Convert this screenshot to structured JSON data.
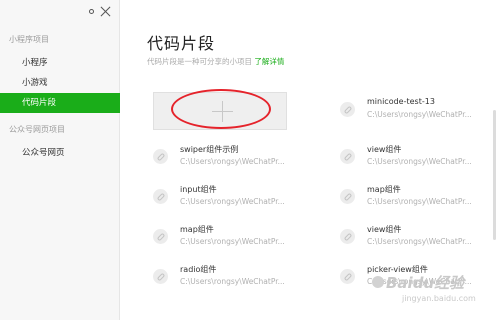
{
  "sidebar": {
    "sections": [
      {
        "title": "小程序项目",
        "items": [
          {
            "label": "小程序",
            "active": false
          },
          {
            "label": "小游戏",
            "active": false
          },
          {
            "label": "代码片段",
            "active": true
          }
        ]
      },
      {
        "title": "公众号网页项目",
        "items": [
          {
            "label": "公众号网页",
            "active": false
          }
        ]
      }
    ]
  },
  "main": {
    "title": "代码片段",
    "subtitle": "代码片段是一种可分享的小项目",
    "link": "了解详情",
    "projects": [
      {
        "name": "minicode-test-13",
        "path": "C:\\Users\\rongsy\\WeChatPr..."
      },
      {
        "name": "swiper组件示例",
        "path": "C:\\Users\\rongsy\\WeChatPr..."
      },
      {
        "name": "view组件",
        "path": "C:\\Users\\rongsy\\WeChatPr..."
      },
      {
        "name": "input组件",
        "path": "C:\\Users\\rongsy\\WeChatPr..."
      },
      {
        "name": "map组件",
        "path": "C:\\Users\\rongsy\\WeChatPr..."
      },
      {
        "name": "map组件",
        "path": "C:\\Users\\rongsy\\WeChatPr..."
      },
      {
        "name": "view组件",
        "path": "C:\\Users\\rongsy\\WeChatPr..."
      },
      {
        "name": "radio组件",
        "path": "C:\\Users\\rongsy\\WeChatPr..."
      },
      {
        "name": "picker-view组件",
        "path": "C:\\Users\\rongsy\\WeChatPr..."
      }
    ]
  },
  "watermark": {
    "brand": "Baidu经验",
    "url": "jingyan.baidu.com"
  },
  "colors": {
    "accent": "#1aad19",
    "annotation": "#e5232b",
    "sidebar_bg": "#f7f7f7"
  }
}
